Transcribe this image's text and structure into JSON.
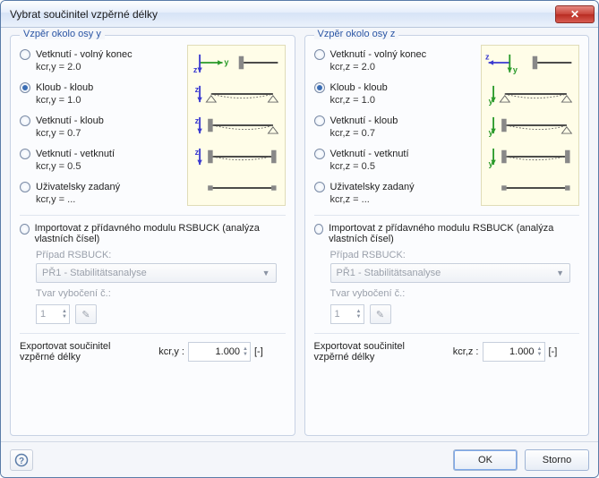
{
  "window": {
    "title": "Vybrat součinitel vzpěrné délky"
  },
  "groups": {
    "y": {
      "title": "Vzpěr okolo osy y",
      "options": [
        {
          "label": "Vetknutí - volný konec",
          "sub": "kcr,y = 2.0",
          "checked": false
        },
        {
          "label": "Kloub - kloub",
          "sub": "kcr,y = 1.0",
          "checked": true
        },
        {
          "label": "Vetknutí - kloub",
          "sub": "kcr,y = 0.7",
          "checked": false
        },
        {
          "label": "Vetknutí - vetknutí",
          "sub": "kcr,y = 0.5",
          "checked": false
        },
        {
          "label": "Uživatelsky zadaný",
          "sub": "kcr,y = ...",
          "checked": false
        }
      ],
      "import": {
        "label": "Importovat z přídavného modulu RSBUCK (analýza vlastních čísel)",
        "checked": false,
        "case_label": "Případ RSBUCK:",
        "case_value": "PŘ1 - Stabilitätsanalyse",
        "shape_label": "Tvar vybočení č.:",
        "shape_value": "1"
      },
      "export": {
        "label": "Exportovat součinitel vzpěrné délky",
        "kcr_label": "kcr,y :",
        "value": "1.000",
        "unit": "[-]"
      }
    },
    "z": {
      "title": "Vzpěr okolo osy z",
      "options": [
        {
          "label": "Vetknutí - volný konec",
          "sub": "kcr,z = 2.0",
          "checked": false
        },
        {
          "label": "Kloub - kloub",
          "sub": "kcr,z = 1.0",
          "checked": true
        },
        {
          "label": "Vetknutí - kloub",
          "sub": "kcr,z = 0.7",
          "checked": false
        },
        {
          "label": "Vetknutí - vetknutí",
          "sub": "kcr,z = 0.5",
          "checked": false
        },
        {
          "label": "Uživatelsky zadaný",
          "sub": "kcr,z = ...",
          "checked": false
        }
      ],
      "import": {
        "label": "Importovat z přídavného modulu RSBUCK (analýza vlastních čísel)",
        "checked": false,
        "case_label": "Případ RSBUCK:",
        "case_value": "PŘ1 - Stabilitätsanalyse",
        "shape_label": "Tvar vybočení č.:",
        "shape_value": "1"
      },
      "export": {
        "label": "Exportovat součinitel vzpěrné délky",
        "kcr_label": "kcr,z :",
        "value": "1.000",
        "unit": "[-]"
      }
    }
  },
  "footer": {
    "ok": "OK",
    "cancel": "Storno"
  }
}
